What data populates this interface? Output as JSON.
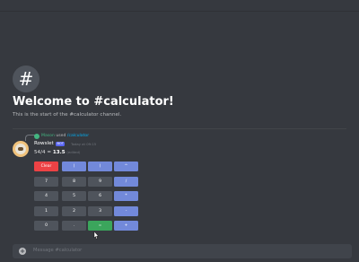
{
  "channel": {
    "hash": "#",
    "welcome": "Welcome to #calculator!",
    "start": "This is the start of the #calculator channel."
  },
  "reply": {
    "user": "Mason",
    "used": "used",
    "command": "/calculator"
  },
  "message": {
    "author": "Rowslet",
    "bot_tag": "BOT",
    "timestamp": "Today at 09:15",
    "expression": "54/4 = ",
    "result": "13.5",
    "edited": "(edited)"
  },
  "calculator": {
    "buttons": [
      "Clear",
      "(",
      ")",
      "^",
      "7",
      "8",
      "9",
      "/",
      "4",
      "5",
      "6",
      "*",
      "1",
      "2",
      "3",
      "-",
      "0",
      ".",
      "=",
      "+"
    ]
  },
  "composer": {
    "plus": "+",
    "placeholder": "Message #calculator"
  }
}
